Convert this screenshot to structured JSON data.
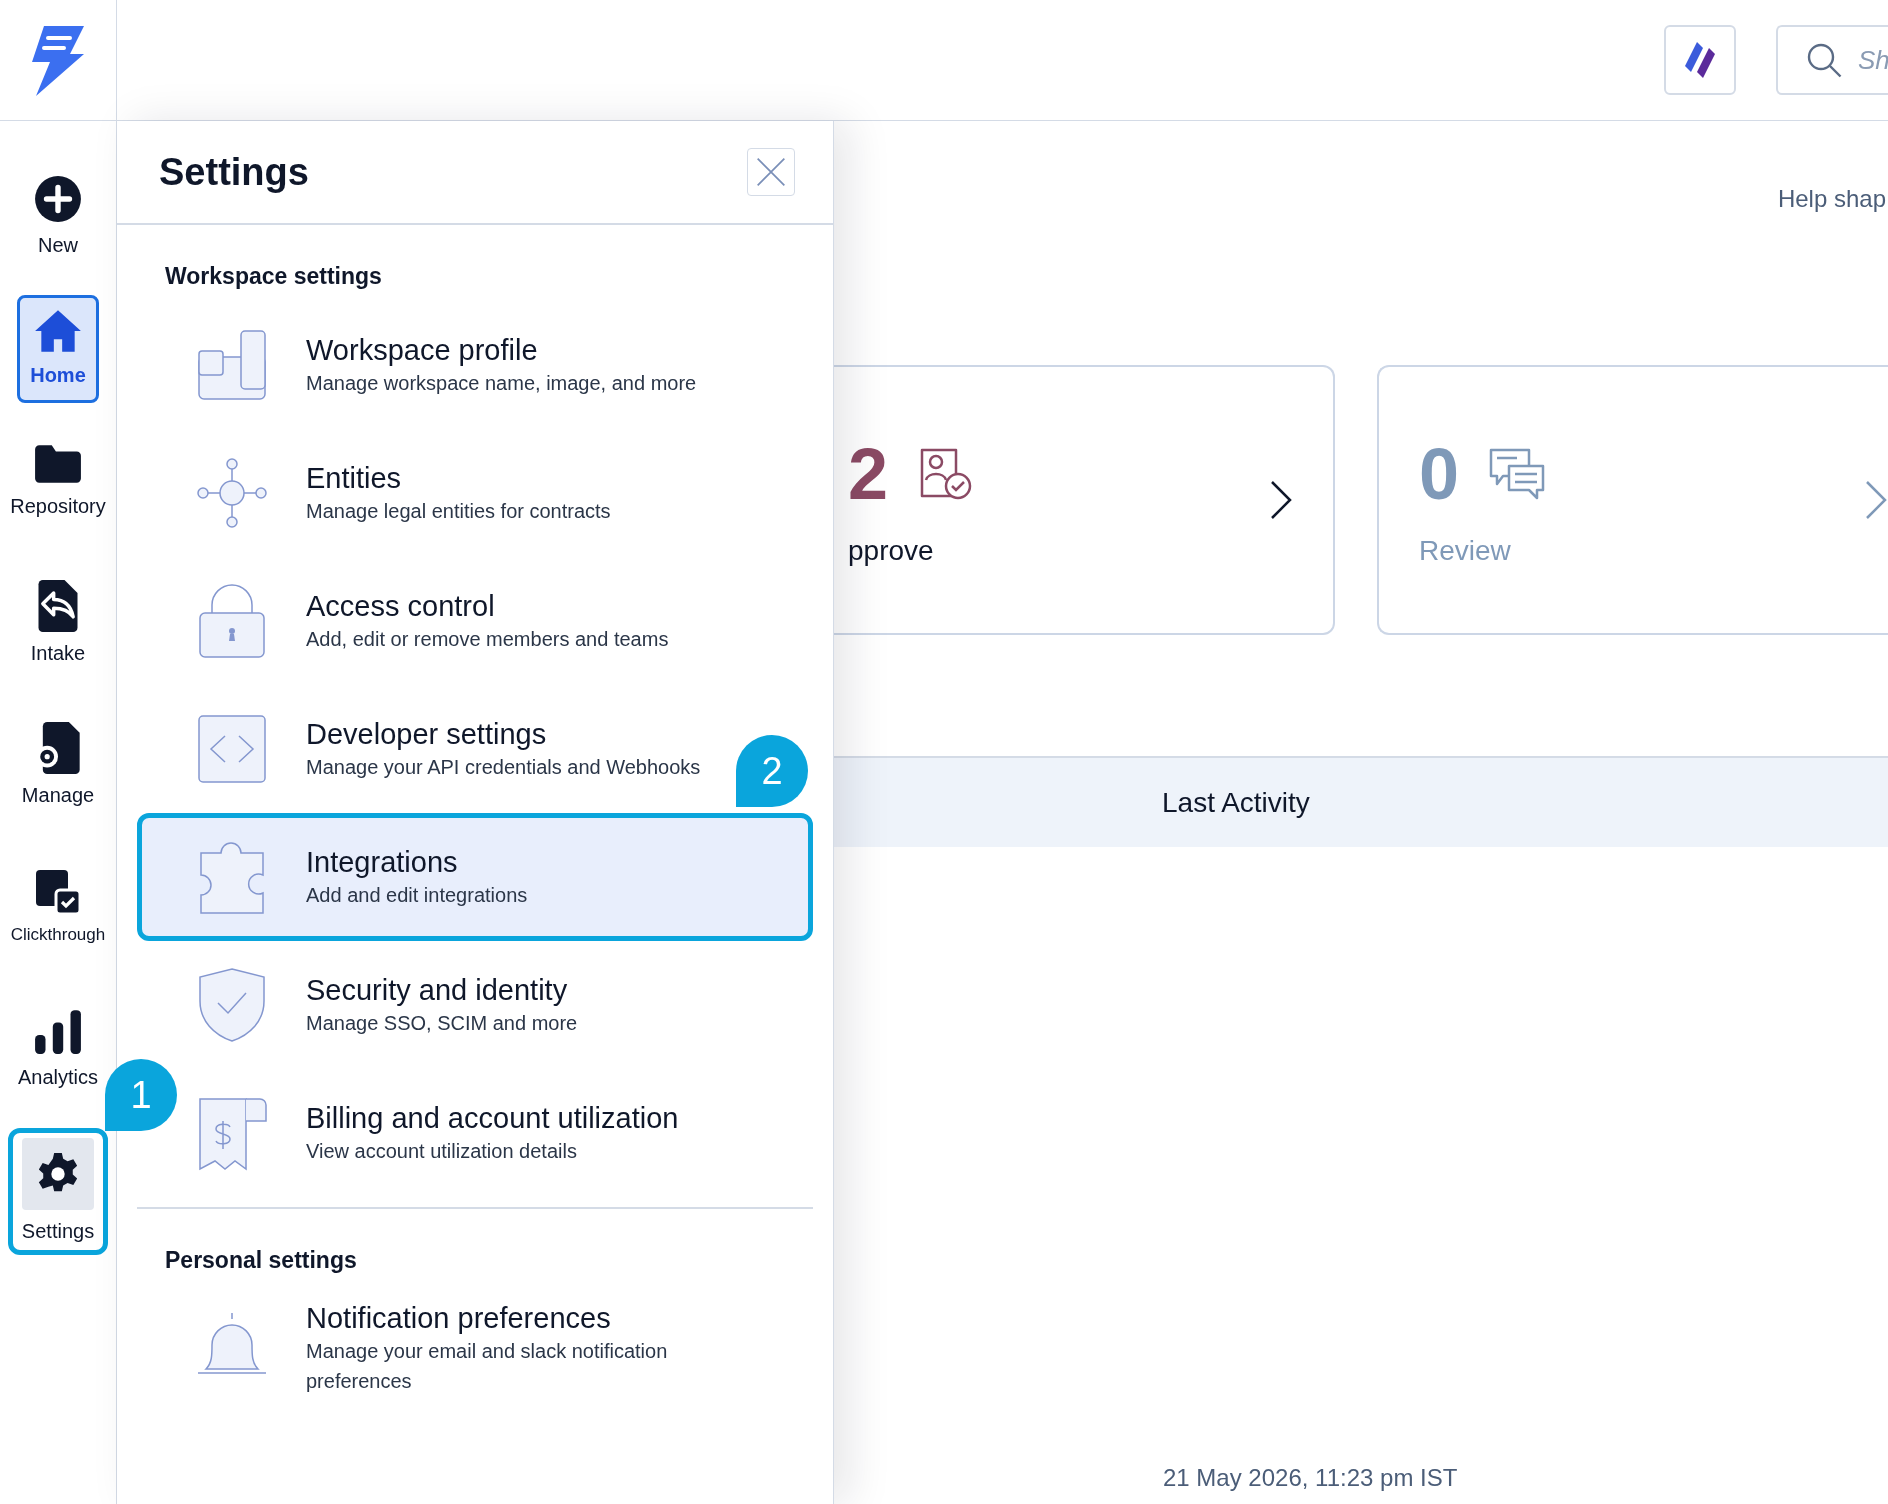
{
  "top_bar": {
    "search": {
      "placeholder": "Sh"
    }
  },
  "rail": [
    {
      "label": "New",
      "selected": false,
      "highlighted": false
    },
    {
      "label": "Home",
      "selected": true,
      "highlighted": false
    },
    {
      "label": "Repository",
      "selected": false,
      "highlighted": false
    },
    {
      "label": "Intake",
      "selected": false,
      "highlighted": false
    },
    {
      "label": "Manage",
      "selected": false,
      "highlighted": false
    },
    {
      "label": "Clickthrough",
      "selected": false,
      "highlighted": false
    },
    {
      "label": "Analytics",
      "selected": false,
      "highlighted": false
    },
    {
      "label": "Settings",
      "selected": false,
      "highlighted": true
    }
  ],
  "settings_panel": {
    "title": "Settings",
    "sections": [
      {
        "heading": "Workspace settings",
        "items": [
          {
            "title": "Workspace profile",
            "description": "Manage workspace name, image, and more",
            "highlighted": false
          },
          {
            "title": "Entities",
            "description": "Manage legal entities for contracts",
            "highlighted": false
          },
          {
            "title": "Access control",
            "description": "Add, edit or remove members and teams",
            "highlighted": false
          },
          {
            "title": "Developer settings",
            "description": "Manage your API credentials and Webhooks",
            "highlighted": false
          },
          {
            "title": "Integrations",
            "description": "Add and edit integrations",
            "highlighted": true
          },
          {
            "title": "Security and identity",
            "description": "Manage SSO, SCIM and more",
            "highlighted": false
          },
          {
            "title": "Billing and account utilization",
            "description": "View account utilization details",
            "highlighted": false
          }
        ]
      },
      {
        "heading": "Personal settings",
        "items": [
          {
            "title": "Notification preferences",
            "description": "Manage your email and slack notification preferences",
            "highlighted": false
          }
        ]
      }
    ]
  },
  "dashboard": {
    "help_text": "Help shap",
    "cards": [
      {
        "count": "2",
        "label": "pprove",
        "color": "#8b4a64",
        "active": true
      },
      {
        "count": "0",
        "label": "Review",
        "color": "#7f99b8",
        "active": false
      }
    ],
    "activity_header": "Last Activity",
    "timestamp": "21 May 2026, 11:23 pm IST"
  },
  "callouts": [
    {
      "number": "1"
    },
    {
      "number": "2"
    }
  ]
}
